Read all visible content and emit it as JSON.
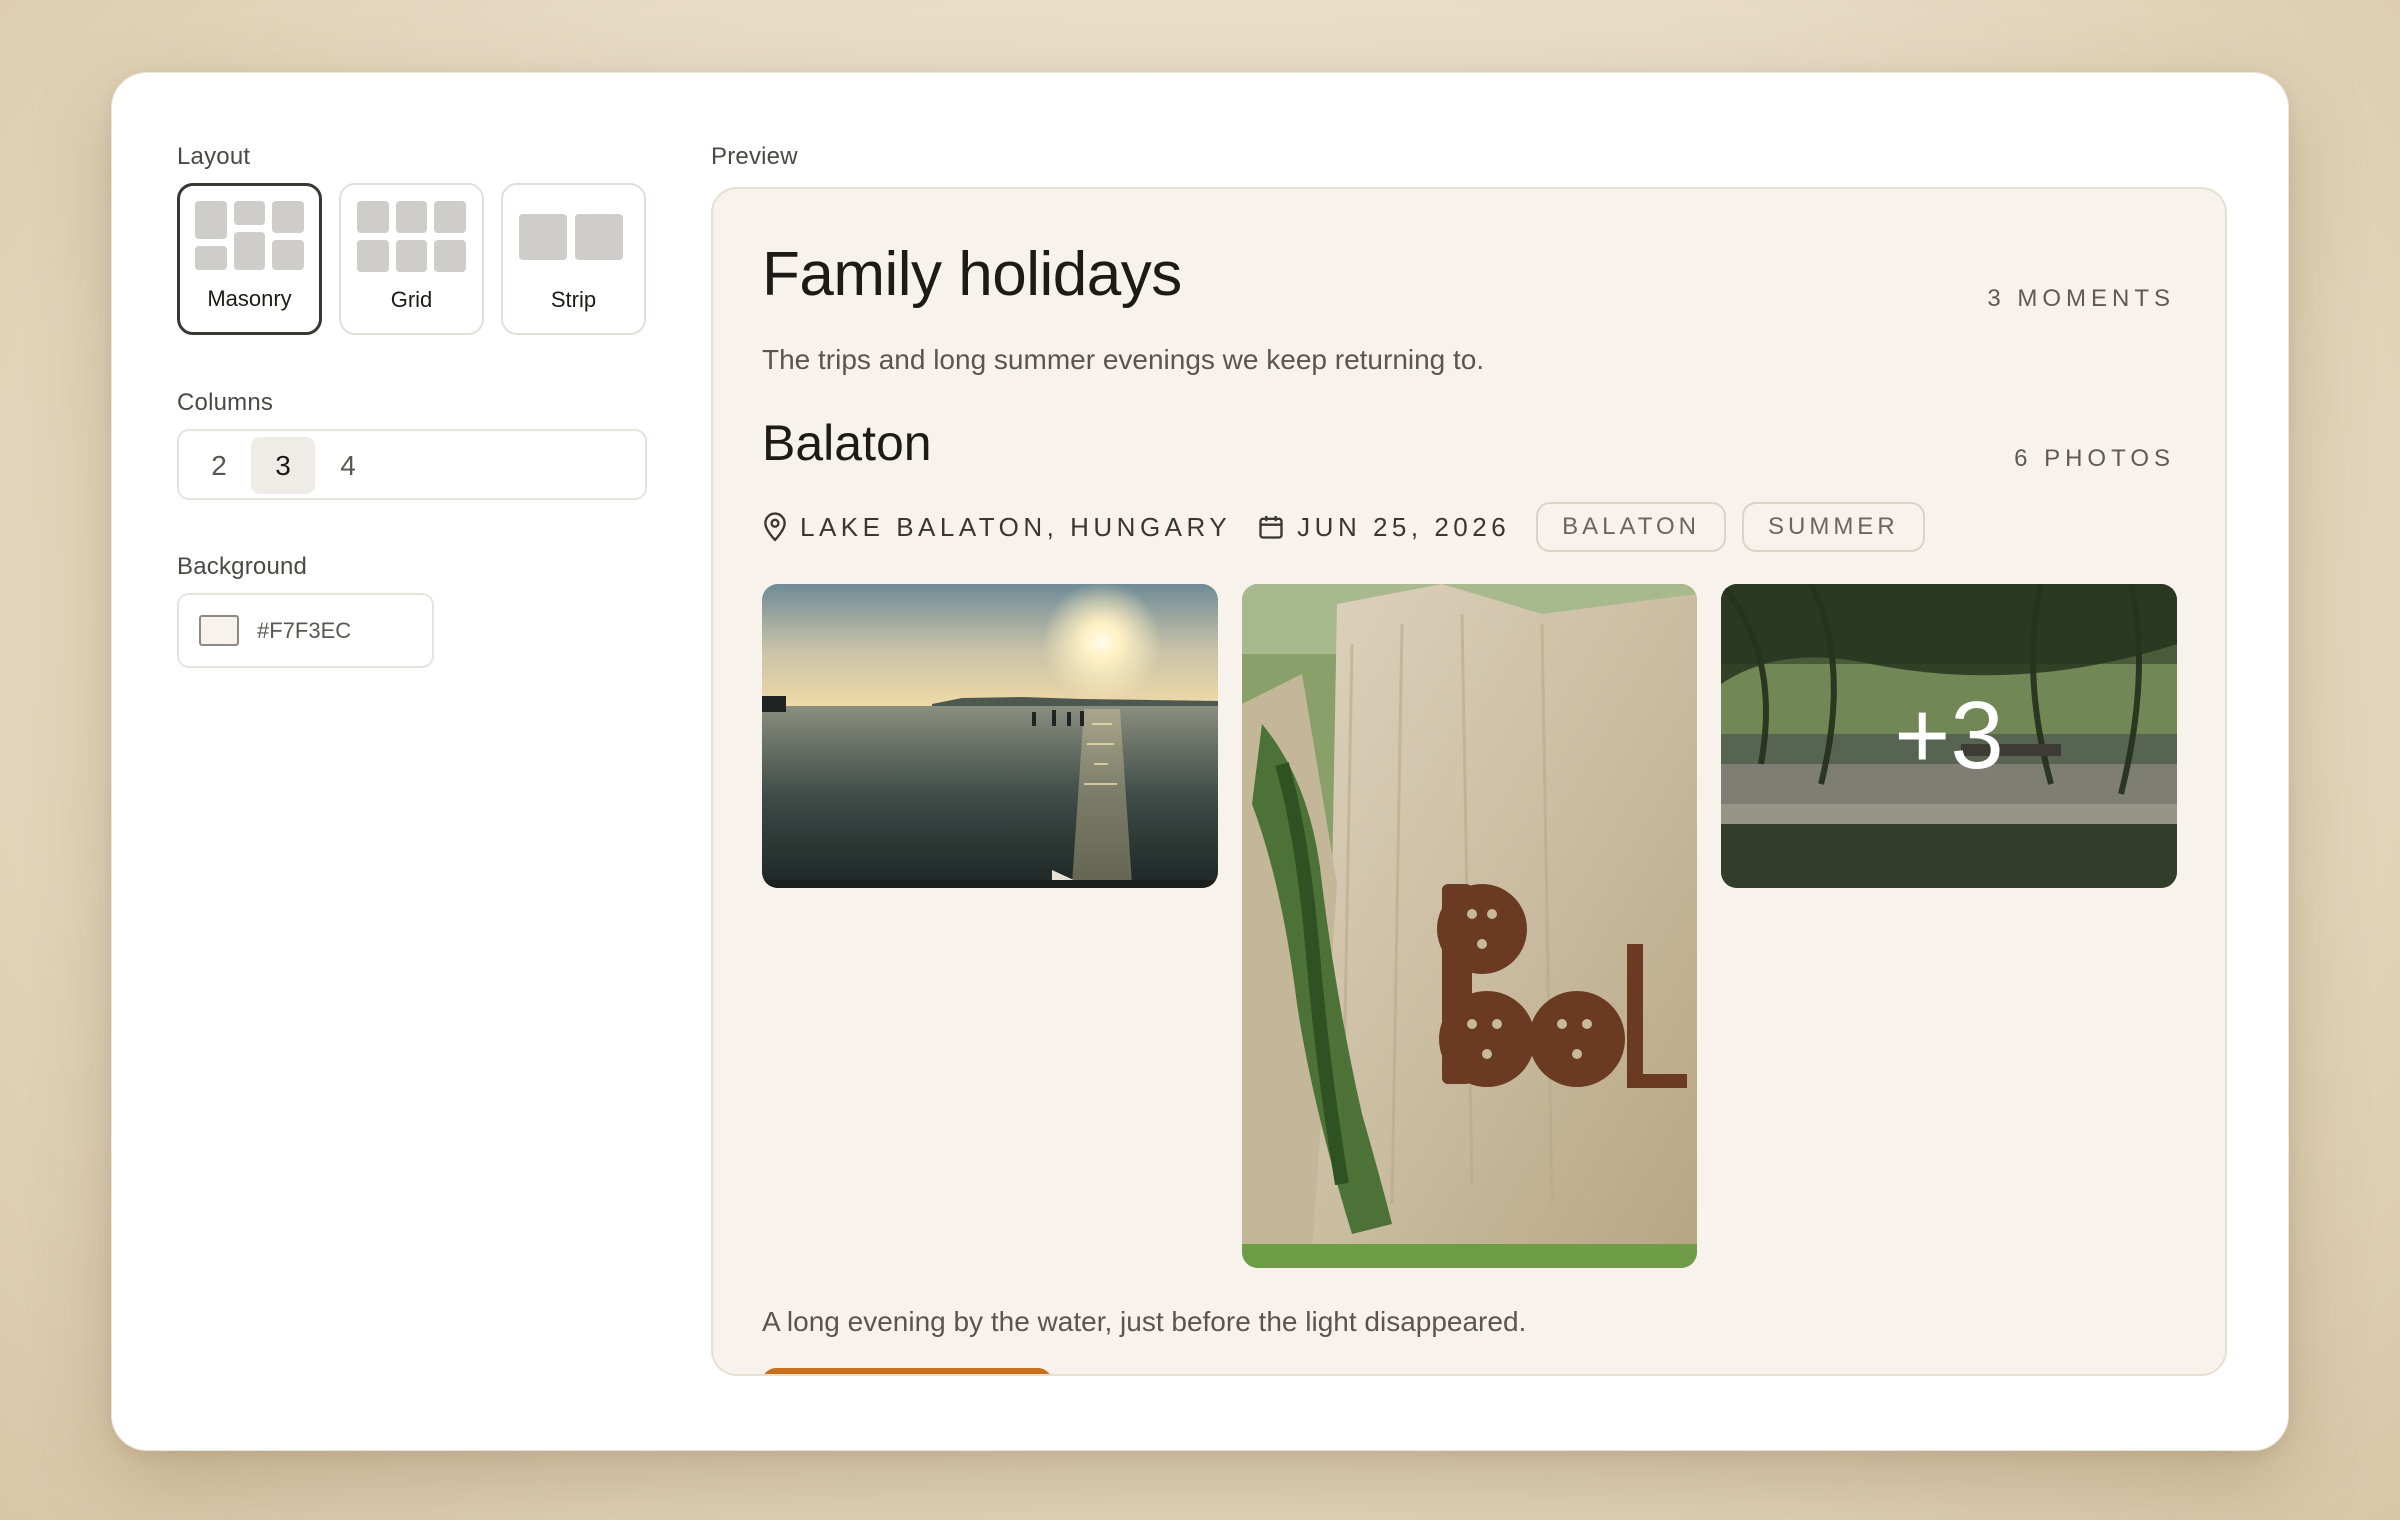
{
  "sidebar": {
    "layout_label": "Layout",
    "layouts": [
      {
        "label": "Masonry",
        "selected": true
      },
      {
        "label": "Grid",
        "selected": false
      },
      {
        "label": "Strip",
        "selected": false
      }
    ],
    "columns_label": "Columns",
    "columns": [
      "2",
      "3",
      "4"
    ],
    "columns_selected": "3",
    "background_label": "Background",
    "background_value": "#F7F3EC"
  },
  "preview": {
    "label": "Preview",
    "background_color": "#F7F3EC",
    "title": "Family holidays",
    "count": "3 MOMENTS",
    "subtitle": "The trips and long summer evenings we keep returning to.",
    "moment": {
      "title": "Balaton",
      "count": "6 PHOTOS",
      "location": "LAKE BALATON, HUNGARY",
      "location_icon": "map-pin-icon",
      "date": "JUN 25, 2026",
      "date_icon": "calendar-icon",
      "tags": [
        "BALATON",
        "SUMMER"
      ],
      "photos": [
        {
          "name": "sunset-lake-photo"
        },
        {
          "name": "balaton-sign-rock-photo"
        },
        {
          "name": "lakeside-park-photo",
          "overlay": "+3"
        }
      ],
      "caption": "A long evening by the water, just before the light disappeared."
    },
    "accent_color": "#C7701B"
  }
}
